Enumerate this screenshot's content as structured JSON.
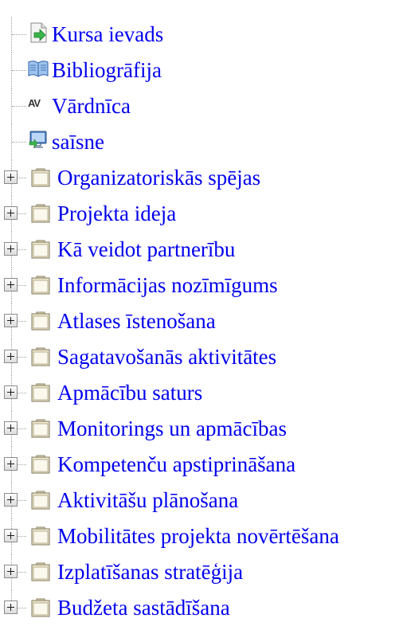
{
  "tree": {
    "leaves": [
      {
        "label": "Kursa ievads",
        "icon": "page-arrow-icon"
      },
      {
        "label": "Bibliogrāfija",
        "icon": "open-book-icon"
      },
      {
        "label": "Vārdnīca",
        "icon": "glossary-av-icon",
        "icon_text": "AV"
      },
      {
        "label": "saīsne",
        "icon": "monitor-link-icon"
      }
    ],
    "folders": [
      {
        "label": "Organizatoriskās spējas"
      },
      {
        "label": "Projekta ideja"
      },
      {
        "label": "Kā veidot partnerību"
      },
      {
        "label": "Informācijas nozīmīgums"
      },
      {
        "label": "Atlases īstenošana"
      },
      {
        "label": "Sagatavošanās aktivitātes"
      },
      {
        "label": "Apmācību saturs"
      },
      {
        "label": "Monitorings un apmācības"
      },
      {
        "label": "Kompetenču apstiprināšana"
      },
      {
        "label": "Aktivitāšu plānošana"
      },
      {
        "label": "Mobilitātes projekta novērtēšana"
      },
      {
        "label": "Izplatīšanas stratēģija"
      },
      {
        "label": "Budžeta sastādīšana"
      }
    ]
  },
  "colors": {
    "link": "#0000ee",
    "connector": "#a0a0a0"
  }
}
